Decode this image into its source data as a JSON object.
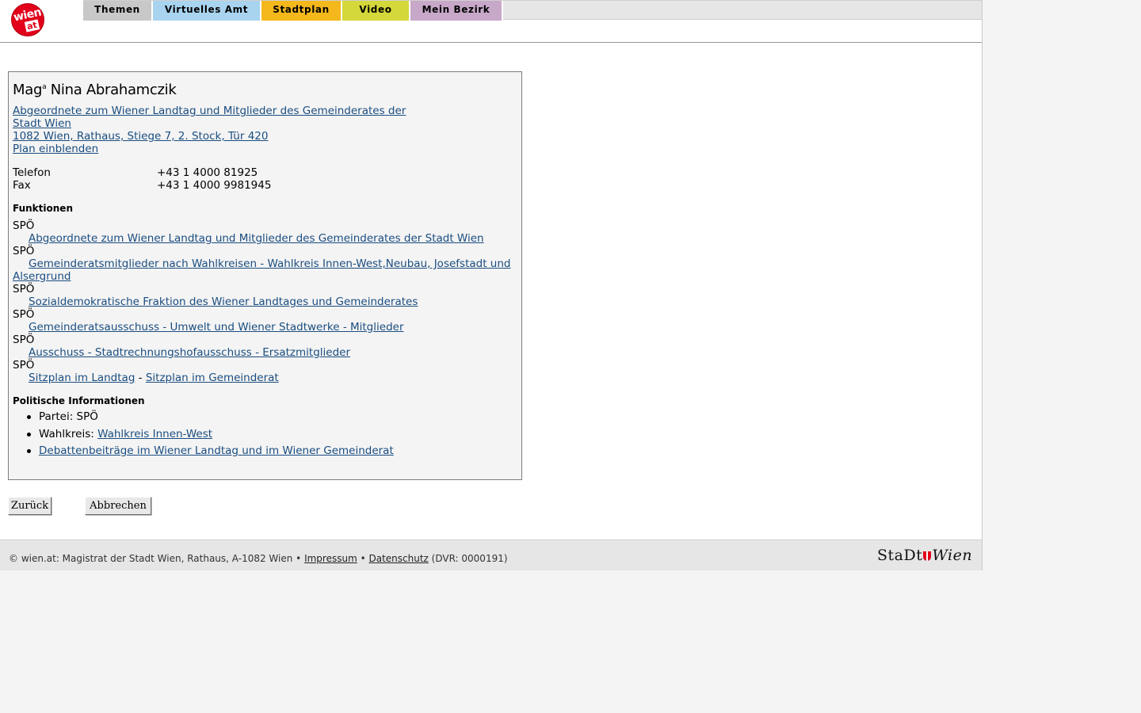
{
  "nav": {
    "logo": {
      "top": "wien",
      "bottom": "at"
    },
    "tabs": [
      {
        "label": "Themen",
        "color": "#c8c8c8"
      },
      {
        "label": "Virtuelles Amt",
        "color": "#a8d4f0"
      },
      {
        "label": "Stadtplan",
        "color": "#f4b81c"
      },
      {
        "label": "Video",
        "color": "#d4d83a"
      },
      {
        "label": "Mein Bezirk",
        "color": "#c8a8c8"
      }
    ]
  },
  "person": {
    "title_prefix": "Mag",
    "title_sup": "a",
    "name": "Nina Abrahamczik",
    "org_line1": "Abgeordnete zum Wiener Landtag und Mitglieder des Gemeinderates der",
    "org_line2": "Stadt Wien ",
    "address": "1082 Wien, Rathaus, Stiege 7, 2. Stock, Tür 420",
    "plan_link": "Plan einblenden",
    "contacts": [
      {
        "label": "Telefon",
        "value": "+43 1 4000 81925"
      },
      {
        "label": "Fax",
        "value": "+43 1 4000 9981945"
      }
    ]
  },
  "functions": {
    "heading": "Funktionen",
    "items": [
      {
        "party": "SPÖ",
        "link": "Abgeordnete zum Wiener Landtag und Mitglieder des Gemeinderates der Stadt Wien"
      },
      {
        "party": "SPÖ",
        "link_line1": "Gemeinderatsmitglieder nach Wahlkreisen - Wahlkreis Innen-West,Neubau, Josefstadt und",
        "link_line2": "Alsergrund"
      },
      {
        "party": "SPÖ",
        "link": "Sozialdemokratische Fraktion des Wiener Landtages und Gemeinderates"
      },
      {
        "party": "SPÖ",
        "link": "Gemeinderatsausschuss - Umwelt und Wiener Stadtwerke - Mitglieder"
      },
      {
        "party": "SPÖ",
        "link": "Ausschuss - Stadtrechnungshofausschuss - Ersatzmitglieder"
      },
      {
        "party": "SPÖ",
        "link_a": "Sitzplan im Landtag",
        "separator": " - ",
        "link_b": "Sitzplan im Gemeinderat"
      }
    ]
  },
  "political": {
    "heading": "Politische Informationen",
    "partei_label": "Partei: SPÖ",
    "wahlkreis_label": "Wahlkreis: ",
    "wahlkreis_link": "Wahlkreis Innen-West",
    "debatten_link": "Debattenbeiträge im Wiener Landtag und im Wiener Gemeinderat"
  },
  "buttons": {
    "back": "Zurück",
    "cancel": "Abbrechen"
  },
  "footer": {
    "copyright": "© wien.at: Magistrat der Stadt Wien, Rathaus, A-1082 Wien • ",
    "impressum": "Impressum",
    "bullet": " • ",
    "datenschutz": "Datenschutz",
    "dvr": " (DVR: 0000191)",
    "brand_left": "StaDt",
    "brand_right": "Wien"
  }
}
